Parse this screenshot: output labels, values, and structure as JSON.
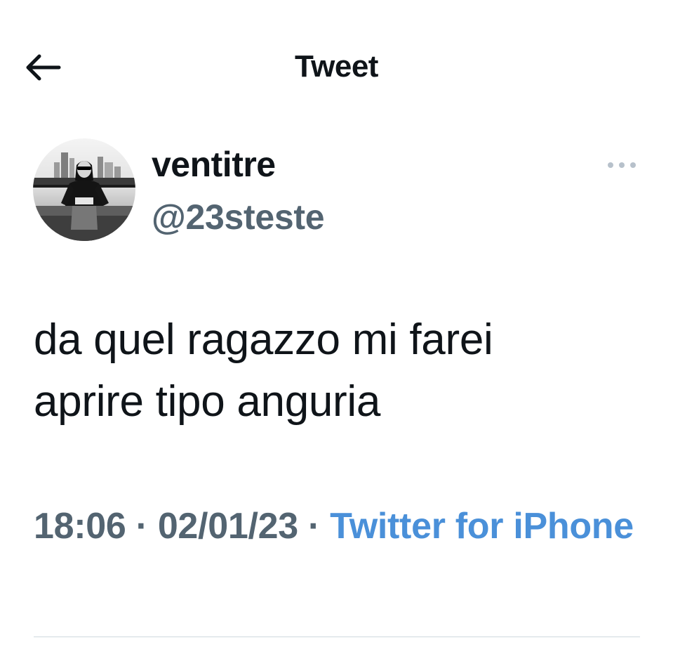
{
  "header": {
    "title": "Tweet",
    "back_icon": "arrow-left-icon"
  },
  "author": {
    "display_name": "ventitre",
    "handle": "@23steste",
    "avatar": "avatar-photo"
  },
  "more_icon": "more-horizontal-icon",
  "tweet": {
    "text_line1": "da quel ragazzo mi farei",
    "text_line2": "aprire tipo anguria"
  },
  "meta": {
    "time": "18:06",
    "separator": " · ",
    "date": "02/01/23",
    "source": "Twitter for iPhone"
  },
  "colors": {
    "text_primary": "#0f1419",
    "text_secondary": "#536471",
    "link": "#4a90d9",
    "divider": "#cfd9de"
  }
}
